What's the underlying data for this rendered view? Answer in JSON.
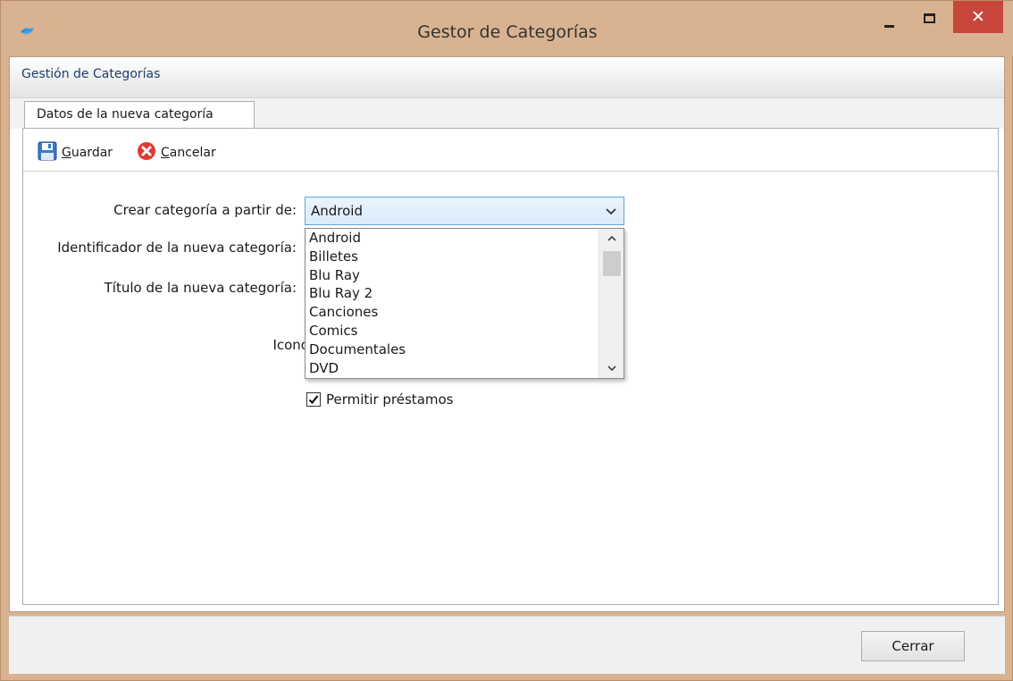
{
  "window": {
    "title": "Gestor de Categorías",
    "close_glyph": "✕"
  },
  "section": {
    "title": "Gestión de Categorías"
  },
  "tabs": [
    {
      "label": "Datos de la nueva categoría"
    }
  ],
  "toolbar": {
    "save_first": "G",
    "save_rest": "uardar",
    "cancel_first": "C",
    "cancel_rest": "ancelar"
  },
  "form": {
    "base_label": "Crear categoría a partir de:",
    "base_value": "Android",
    "base_options": [
      "Android",
      "Billetes",
      "Blu Ray",
      "Blu Ray 2",
      "Canciones",
      "Comics",
      "Documentales",
      "DVD"
    ],
    "id_label": "Identificador de la nueva categoría:",
    "title_label": "Título de la nueva categoría:",
    "icon_label": "Icono",
    "loans_label": "Permitir préstamos",
    "loans_checked": true
  },
  "footer": {
    "close_label": "Cerrar"
  },
  "colors": {
    "frame": "#d9b391",
    "close_button": "#c8463c",
    "combo_border": "#64a1db",
    "header_text": "#1e3f6e"
  }
}
